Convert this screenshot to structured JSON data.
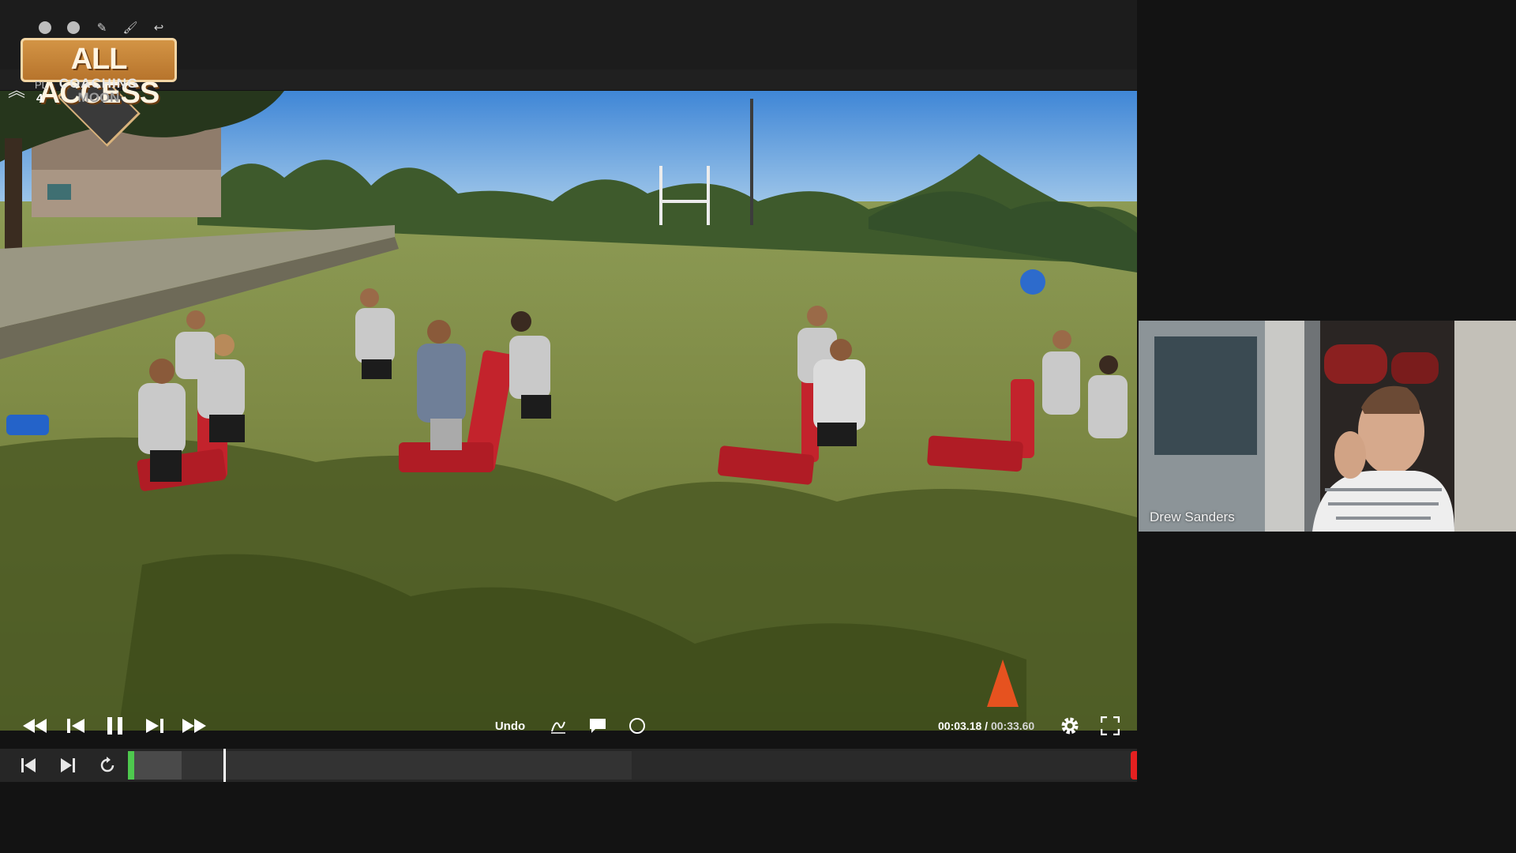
{
  "logo": {
    "title": "ALL ACCESS",
    "line2": "COACHING",
    "line3": "MOON"
  },
  "header": {
    "play_label": "PL",
    "play_count": "4",
    "top_icons": [
      "circle-icon",
      "circle-icon",
      "pencil-icon",
      "brush-icon",
      "hook-icon"
    ]
  },
  "player": {
    "undo_label": "Undo",
    "current_time": "00:03.18",
    "separator": " / ",
    "duration": "00:33.60",
    "progress_fraction": 0.095,
    "buffered_fraction": 0.053
  },
  "participant": {
    "name": "Drew Sanders"
  },
  "colors": {
    "accent": "#d39445",
    "timeline_start": "#4ec94e",
    "timeline_end": "#e52020"
  }
}
